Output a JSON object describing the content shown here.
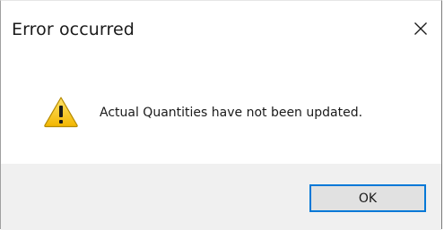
{
  "dialog": {
    "title": "Error occurred",
    "message": "Actual Quantities have not been updated.",
    "ok_label": "OK"
  },
  "icons": {
    "close": "close-icon",
    "warning": "warning-icon"
  },
  "colors": {
    "accent": "#0078d7",
    "footer_bg": "#f0f0f0",
    "warning_yellow": "#f5c400"
  }
}
